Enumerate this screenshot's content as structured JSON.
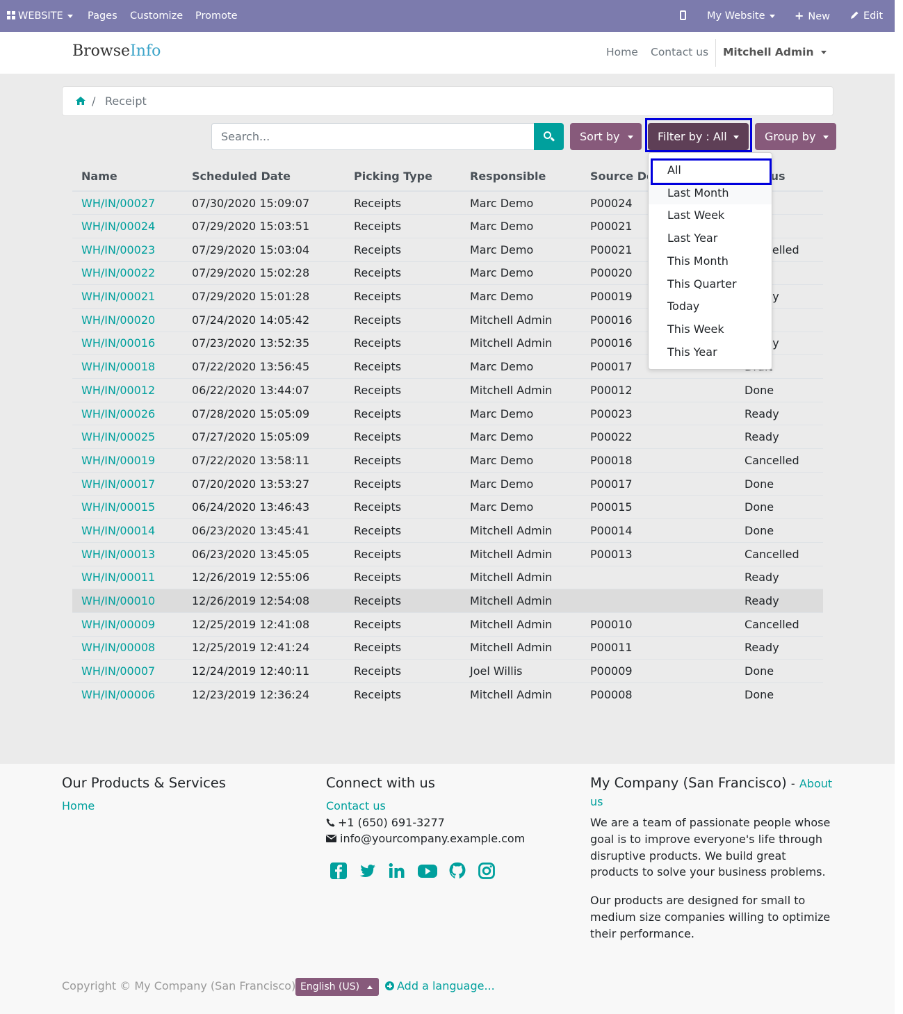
{
  "admin_bar": {
    "website_label": "WEBSITE",
    "pages_label": "Pages",
    "customize_label": "Customize",
    "promote_label": "Promote",
    "site_selector_label": "My Website",
    "new_label": "New",
    "edit_label": "Edit"
  },
  "header": {
    "logo_part1": "Browse",
    "logo_part2": "Info",
    "nav_home": "Home",
    "nav_contact": "Contact us",
    "user_name": "Mitchell Admin"
  },
  "breadcrumb": {
    "separator": "/",
    "current": "Receipt"
  },
  "search": {
    "placeholder": "Search..."
  },
  "controls": {
    "sort_label": "Sort by",
    "filter_label": "Filter by : All",
    "group_label": "Group by"
  },
  "filter_dropdown": {
    "items": [
      "All",
      "Last Month",
      "Last Week",
      "Last Year",
      "This Month",
      "This Quarter",
      "Today",
      "This Week",
      "This Year"
    ],
    "selected": "All"
  },
  "table": {
    "columns": [
      "Name",
      "Scheduled Date",
      "Picking Type",
      "Responsible",
      "Source Document",
      "Status"
    ],
    "rows": [
      {
        "name": "WH/IN/00027",
        "date": "07/30/2020 15:09:07",
        "type": "Receipts",
        "responsible": "Marc Demo",
        "source": "P00024",
        "status": ""
      },
      {
        "name": "WH/IN/00024",
        "date": "07/29/2020 15:03:51",
        "type": "Receipts",
        "responsible": "Marc Demo",
        "source": "P00021",
        "status": ""
      },
      {
        "name": "WH/IN/00023",
        "date": "07/29/2020 15:03:04",
        "type": "Receipts",
        "responsible": "Marc Demo",
        "source": "P00021",
        "status": "Cancelled"
      },
      {
        "name": "WH/IN/00022",
        "date": "07/29/2020 15:02:28",
        "type": "Receipts",
        "responsible": "Marc Demo",
        "source": "P00020",
        "status": ""
      },
      {
        "name": "WH/IN/00021",
        "date": "07/29/2020 15:01:28",
        "type": "Receipts",
        "responsible": "Marc Demo",
        "source": "P00019",
        "status": "Ready"
      },
      {
        "name": "WH/IN/00020",
        "date": "07/24/2020 14:05:42",
        "type": "Receipts",
        "responsible": "Mitchell Admin",
        "source": "P00016",
        "status": ""
      },
      {
        "name": "WH/IN/00016",
        "date": "07/23/2020 13:52:35",
        "type": "Receipts",
        "responsible": "Mitchell Admin",
        "source": "P00016",
        "status": "Ready"
      },
      {
        "name": "WH/IN/00018",
        "date": "07/22/2020 13:56:45",
        "type": "Receipts",
        "responsible": "Marc Demo",
        "source": "P00017",
        "status": "Draft"
      },
      {
        "name": "WH/IN/00012",
        "date": "06/22/2020 13:44:07",
        "type": "Receipts",
        "responsible": "Mitchell Admin",
        "source": "P00012",
        "status": "Done"
      },
      {
        "name": "WH/IN/00026",
        "date": "07/28/2020 15:05:09",
        "type": "Receipts",
        "responsible": "Marc Demo",
        "source": "P00023",
        "status": "Ready"
      },
      {
        "name": "WH/IN/00025",
        "date": "07/27/2020 15:05:09",
        "type": "Receipts",
        "responsible": "Marc Demo",
        "source": "P00022",
        "status": "Ready"
      },
      {
        "name": "WH/IN/00019",
        "date": "07/22/2020 13:58:11",
        "type": "Receipts",
        "responsible": "Marc Demo",
        "source": "P00018",
        "status": "Cancelled"
      },
      {
        "name": "WH/IN/00017",
        "date": "07/20/2020 13:53:27",
        "type": "Receipts",
        "responsible": "Marc Demo",
        "source": "P00017",
        "status": "Done"
      },
      {
        "name": "WH/IN/00015",
        "date": "06/24/2020 13:46:43",
        "type": "Receipts",
        "responsible": "Marc Demo",
        "source": "P00015",
        "status": "Done"
      },
      {
        "name": "WH/IN/00014",
        "date": "06/23/2020 13:45:41",
        "type": "Receipts",
        "responsible": "Mitchell Admin",
        "source": "P00014",
        "status": "Done"
      },
      {
        "name": "WH/IN/00013",
        "date": "06/23/2020 13:45:05",
        "type": "Receipts",
        "responsible": "Mitchell Admin",
        "source": "P00013",
        "status": "Cancelled"
      },
      {
        "name": "WH/IN/00011",
        "date": "12/26/2019 12:55:06",
        "type": "Receipts",
        "responsible": "Mitchell Admin",
        "source": "",
        "status": "Ready"
      },
      {
        "name": "WH/IN/00010",
        "date": "12/26/2019 12:54:08",
        "type": "Receipts",
        "responsible": "Mitchell Admin",
        "source": "",
        "status": "Ready"
      },
      {
        "name": "WH/IN/00009",
        "date": "12/25/2019 12:41:08",
        "type": "Receipts",
        "responsible": "Mitchell Admin",
        "source": "P00010",
        "status": "Cancelled"
      },
      {
        "name": "WH/IN/00008",
        "date": "12/25/2019 12:41:24",
        "type": "Receipts",
        "responsible": "Mitchell Admin",
        "source": "P00011",
        "status": "Ready"
      },
      {
        "name": "WH/IN/00007",
        "date": "12/24/2019 12:40:11",
        "type": "Receipts",
        "responsible": "Joel Willis",
        "source": "P00009",
        "status": "Done"
      },
      {
        "name": "WH/IN/00006",
        "date": "12/23/2019 12:36:24",
        "type": "Receipts",
        "responsible": "Mitchell Admin",
        "source": "P00008",
        "status": "Done"
      }
    ]
  },
  "footer": {
    "products_heading": "Our Products & Services",
    "products_link": "Home",
    "connect_heading": "Connect with us",
    "contact_link": "Contact us",
    "phone": "+1 (650) 691-3277",
    "email": "info@yourcompany.example.com",
    "social_icons": [
      "facebook-icon",
      "twitter-icon",
      "linkedin-icon",
      "youtube-icon",
      "github-icon",
      "instagram-icon"
    ],
    "company_heading": "My Company (San Francisco)",
    "company_dash": "-",
    "about_link_1": "About",
    "about_link_2": "us",
    "about_para_1": "We are a team of passionate people whose goal is to improve everyone's life through disruptive products. We build great products to solve your business problems.",
    "about_para_2": "Our products are designed for small to medium size companies willing to optimize their performance.",
    "copyright": "Copyright © My Company (San Francisco)",
    "language": "English (US)",
    "add_language": "Add a language..."
  },
  "colors": {
    "admin_bar": "#7c7bad",
    "primary": "#875a7b",
    "primary_dark": "#5e3f56",
    "link": "#00a09d",
    "highlight": "#0000dd"
  }
}
